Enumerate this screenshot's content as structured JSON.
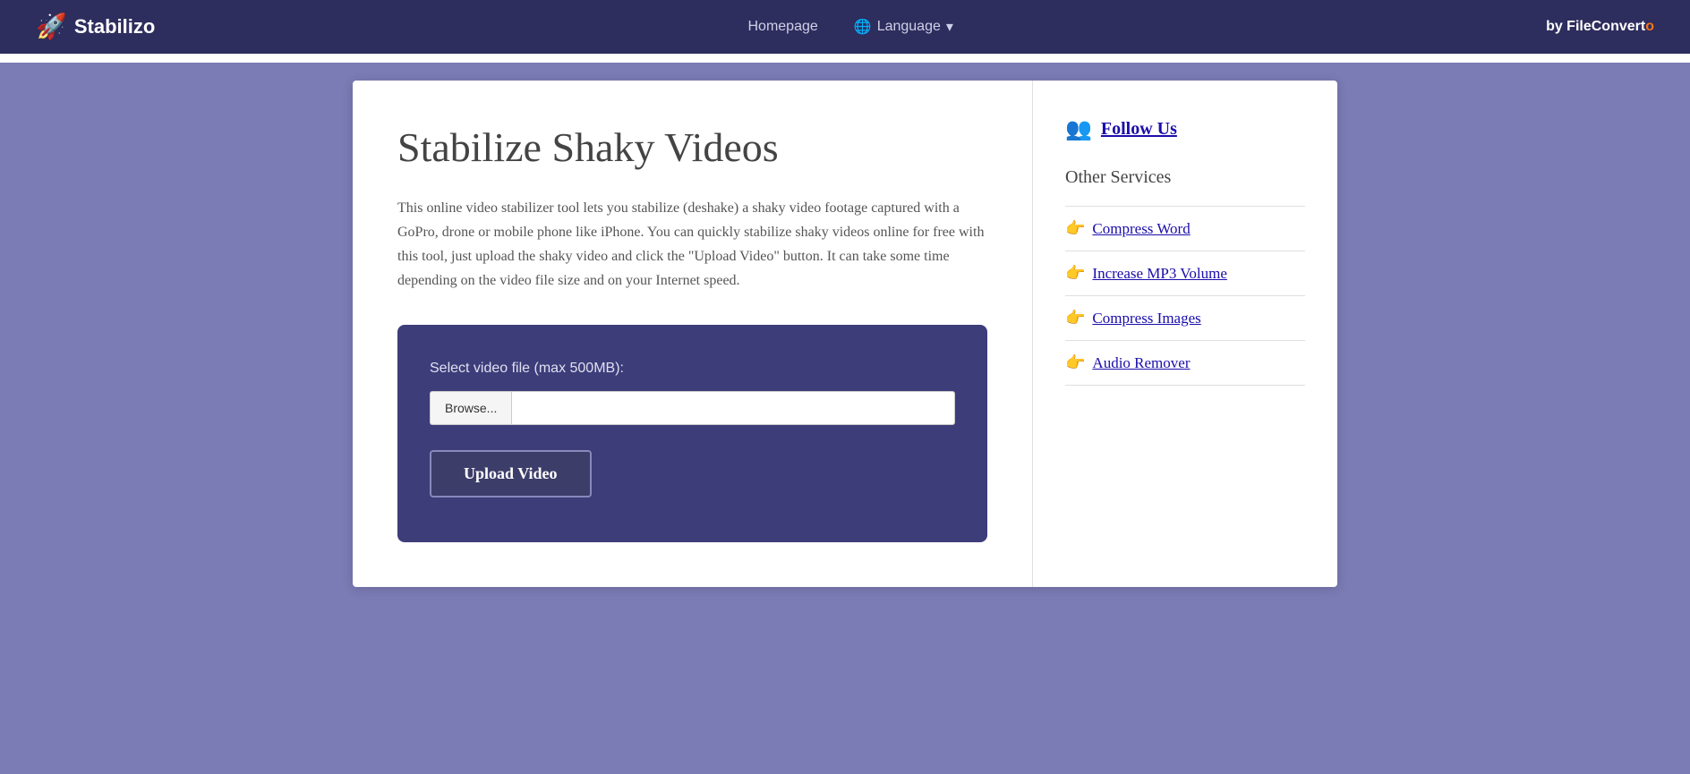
{
  "header": {
    "logo_icon": "🚀",
    "logo_text": "Stabilizo",
    "nav_home": "Homepage",
    "nav_language": "Language",
    "nav_language_icon": "🌐",
    "brand_prefix": "by FileConvert",
    "brand_highlight": "o"
  },
  "main": {
    "page_title": "Stabilize Shaky Videos",
    "description": "This online video stabilizer tool lets you stabilize (deshake) a shaky video footage captured with a GoPro, drone or mobile phone like iPhone. You can quickly stabilize shaky videos online for free with this tool, just upload the shaky video and click the \"Upload Video\" button. It can take some time depending on the video file size and on your Internet speed.",
    "upload_box": {
      "label": "Select video file (max 500MB):",
      "browse_label": "Browse...",
      "upload_btn_label": "Upload Video"
    }
  },
  "sidebar": {
    "follow_icon": "👥",
    "follow_label": "Follow Us",
    "other_services_title": "Other Services",
    "services": [
      {
        "icon": "👉",
        "label": "Compress Word"
      },
      {
        "icon": "👉",
        "label": "Increase MP3 Volume"
      },
      {
        "icon": "👉",
        "label": "Compress Images"
      },
      {
        "icon": "👉",
        "label": "Audio Remover"
      }
    ]
  }
}
